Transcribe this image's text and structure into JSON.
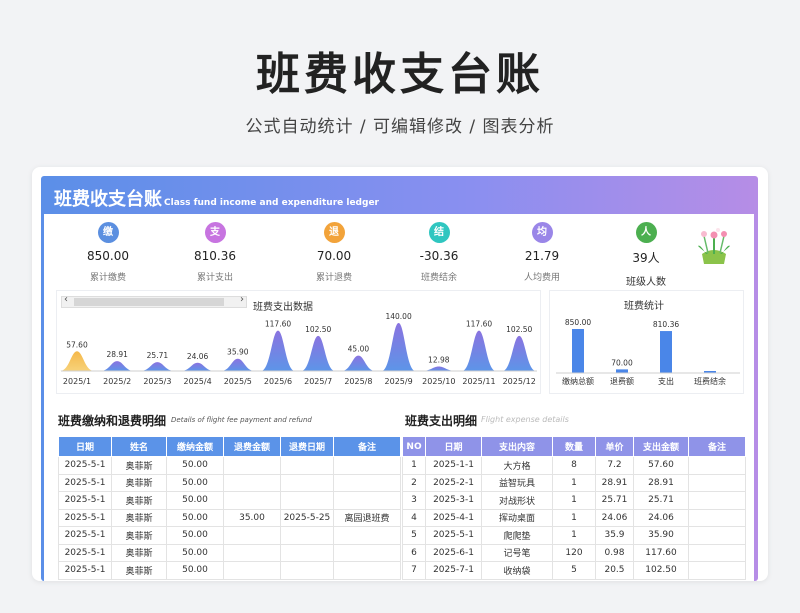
{
  "hero": {
    "title": "班费收支台账",
    "subtitle": "公式自动统计 /  可编辑修改  /  图表分析"
  },
  "sheet": {
    "title": "班费收支台账",
    "title_en": "Class fund income and expenditure ledger"
  },
  "kpis": [
    {
      "badge": "缴",
      "value": "850.00",
      "label": "累计缴费",
      "color": "#5b8fe0"
    },
    {
      "badge": "支",
      "value": "810.36",
      "label": "累计支出",
      "color": "#c774e0"
    },
    {
      "badge": "退",
      "value": "70.00",
      "label": "累计退费",
      "color": "#f2a33a"
    },
    {
      "badge": "结",
      "value": "-30.36",
      "label": "班费结余",
      "color": "#2fc6c0"
    },
    {
      "badge": "均",
      "value": "21.79",
      "label": "人均费用",
      "color": "#9a86e8"
    },
    {
      "badge": "人",
      "value": "39人",
      "label": "班级人数",
      "color": "#4caf50"
    }
  ],
  "colors": {
    "accent_blue": "#5b93e8",
    "accent_purple": "#8f93e8",
    "bar": "#4a86e8"
  },
  "chart_left_title": "班费支出数据",
  "chart_right_title": "班费统计",
  "chart_data": [
    {
      "type": "area",
      "title": "班费支出数据",
      "categories": [
        "2025/1",
        "2025/2",
        "2025/3",
        "2025/4",
        "2025/5",
        "2025/6",
        "2025/7",
        "2025/8",
        "2025/9",
        "2025/10",
        "2025/11",
        "2025/12"
      ],
      "values": [
        57.6,
        28.91,
        25.71,
        24.06,
        35.9,
        117.6,
        102.5,
        45.0,
        140.0,
        12.98,
        117.6,
        102.5
      ],
      "labels": [
        "57.60",
        "28.91",
        "25.71",
        "24.06",
        "35.90",
        "117.60",
        "102.50",
        "45.00",
        "140.00",
        "12.98",
        "117.60",
        "102.50"
      ]
    },
    {
      "type": "bar",
      "title": "班费统计",
      "categories": [
        "缴纳总额",
        "退费额",
        "支出",
        "班费结余"
      ],
      "values": [
        850.0,
        70.0,
        810.36,
        -30.36
      ],
      "labels": [
        "850.00",
        "70.00",
        "810.36",
        ""
      ]
    }
  ],
  "left_table": {
    "title": "班费缴纳和退费明细",
    "subtitle": "Details of flight fee payment and refund",
    "headers": [
      "日期",
      "姓名",
      "缴纳金额",
      "退费金额",
      "退费日期",
      "备注"
    ],
    "rows": [
      [
        "2025-5-1",
        "奥菲斯",
        "50.00",
        "",
        "",
        ""
      ],
      [
        "2025-5-1",
        "奥菲斯",
        "50.00",
        "",
        "",
        ""
      ],
      [
        "2025-5-1",
        "奥菲斯",
        "50.00",
        "",
        "",
        ""
      ],
      [
        "2025-5-1",
        "奥菲斯",
        "50.00",
        "35.00",
        "2025-5-25",
        "离园退班费"
      ],
      [
        "2025-5-1",
        "奥菲斯",
        "50.00",
        "",
        "",
        ""
      ],
      [
        "2025-5-1",
        "奥菲斯",
        "50.00",
        "",
        "",
        ""
      ],
      [
        "2025-5-1",
        "奥菲斯",
        "50.00",
        "",
        "",
        ""
      ]
    ]
  },
  "right_table": {
    "title": "班费支出明细",
    "subtitle": "Flight expense details",
    "headers": [
      "NO",
      "日期",
      "支出内容",
      "数量",
      "单价",
      "支出金额",
      "备注"
    ],
    "rows": [
      [
        "1",
        "2025-1-1",
        "大方格",
        "8",
        "7.2",
        "57.60",
        ""
      ],
      [
        "2",
        "2025-2-1",
        "益智玩具",
        "1",
        "28.91",
        "28.91",
        ""
      ],
      [
        "3",
        "2025-3-1",
        "对战形状",
        "1",
        "25.71",
        "25.71",
        ""
      ],
      [
        "4",
        "2025-4-1",
        "挥动桌面",
        "1",
        "24.06",
        "24.06",
        ""
      ],
      [
        "5",
        "2025-5-1",
        "爬爬垫",
        "1",
        "35.9",
        "35.90",
        ""
      ],
      [
        "6",
        "2025-6-1",
        "记号笔",
        "120",
        "0.98",
        "117.60",
        ""
      ],
      [
        "7",
        "2025-7-1",
        "收纳袋",
        "5",
        "20.5",
        "102.50",
        ""
      ]
    ]
  }
}
